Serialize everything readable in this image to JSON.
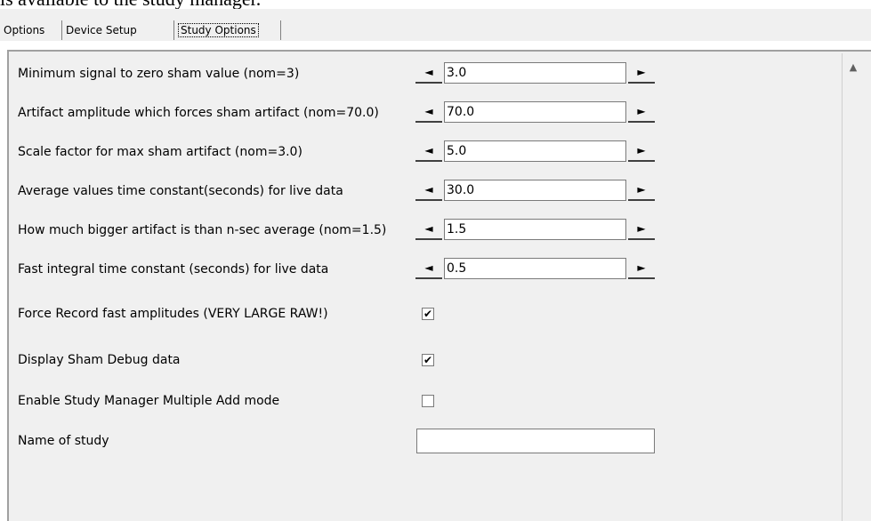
{
  "caption": "is available to the study manager.",
  "tabs": [
    {
      "label": "Options"
    },
    {
      "label": "Device Setup"
    },
    {
      "label": "Study Options"
    }
  ],
  "active_tab": "Study Options",
  "spinners": [
    {
      "label": "Minimum signal to zero sham value (nom=3)",
      "value": "3.0"
    },
    {
      "label": "Artifact amplitude which forces sham artifact (nom=70.0)",
      "value": "70.0"
    },
    {
      "label": "Scale factor for max sham artifact (nom=3.0)",
      "value": "5.0"
    },
    {
      "label": "Average values time constant(seconds) for live data",
      "value": "30.0"
    },
    {
      "label": "How much bigger artifact is than n-sec average (nom=1.5)",
      "value": "1.5"
    },
    {
      "label": "Fast integral time constant (seconds) for live data",
      "value": "0.5"
    }
  ],
  "checkboxes": [
    {
      "label": "Force Record fast amplitudes (VERY LARGE RAW!)",
      "checked": true,
      "mark": "✔"
    },
    {
      "label": "Display Sham Debug data",
      "checked": true,
      "mark": "✔"
    },
    {
      "label": "Enable Study Manager Multiple Add mode",
      "checked": false,
      "mark": ""
    }
  ],
  "name_of_study": {
    "label": "Name of study",
    "value": ""
  },
  "icons": {
    "spin_left": "◄",
    "spin_right": "►",
    "scroll_up": "▲"
  }
}
